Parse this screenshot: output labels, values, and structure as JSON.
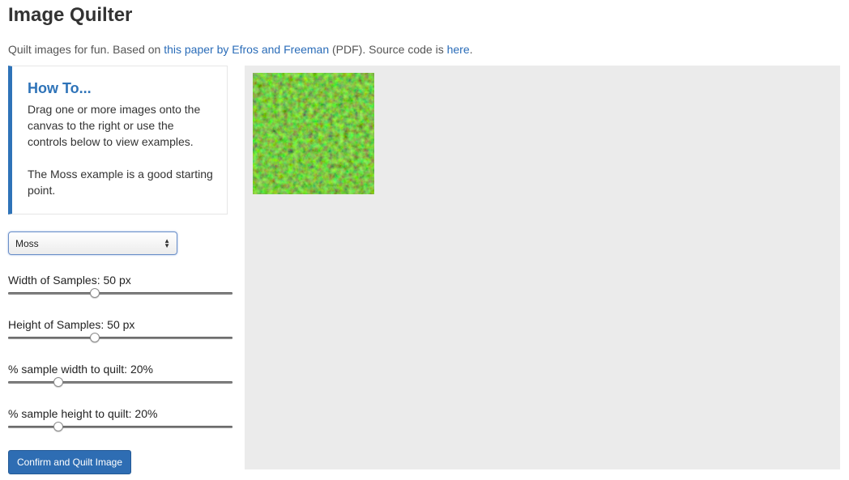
{
  "header": {
    "title": "Image Quilter"
  },
  "intro": {
    "text_before": "Quilt images for fun. Based on ",
    "paper_link": "this paper by Efros and Freeman",
    "text_middle": " (PDF). Source code is ",
    "source_link": "here",
    "text_after": "."
  },
  "howto": {
    "title": "How To...",
    "paragraph1": "Drag one or more images onto the canvas to the right or use the controls below to view examples.",
    "paragraph2": "The Moss example is a good starting point."
  },
  "example_select": {
    "selected": "Moss"
  },
  "sliders": [
    {
      "label": "Width of Samples: 50 px",
      "value_fraction": 0.38
    },
    {
      "label": "Height of Samples: 50 px",
      "value_fraction": 0.38
    },
    {
      "label": "% sample width to quilt: 20%",
      "value_fraction": 0.21
    },
    {
      "label": "% sample height to quilt: 20%",
      "value_fraction": 0.21
    }
  ],
  "confirm_button": {
    "label": "Confirm and Quilt Image"
  },
  "canvas": {
    "sample_image": "moss-texture"
  },
  "colors": {
    "accent": "#2e73b8",
    "link": "#2a6cb8",
    "button_bg": "#2e6db3",
    "canvas_bg": "#ebebeb"
  }
}
